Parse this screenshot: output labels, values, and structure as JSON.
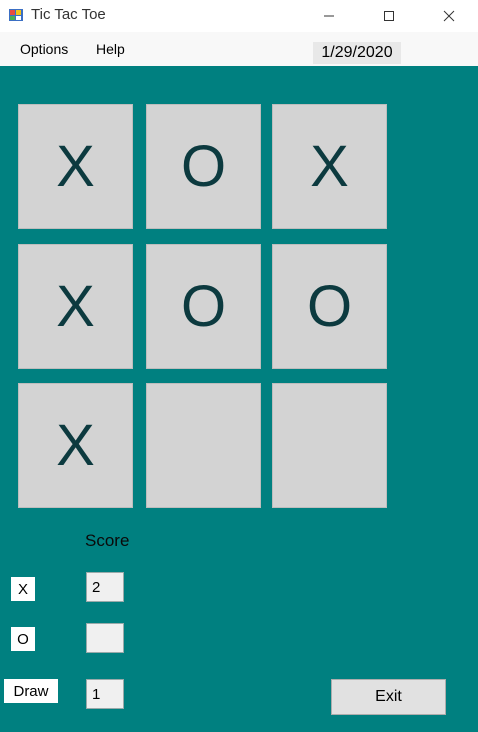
{
  "window": {
    "title": "Tic Tac Toe"
  },
  "menu": {
    "options": "Options",
    "help": "Help"
  },
  "date": "1/29/2020",
  "board": {
    "cells": [
      "X",
      "O",
      "X",
      "X",
      "O",
      "O",
      "X",
      "",
      ""
    ]
  },
  "score": {
    "title": "Score",
    "x_label": "X",
    "x_value": "2",
    "o_label": "O",
    "o_value": "",
    "draw_label": "Draw",
    "draw_value": "1"
  },
  "exit_label": "Exit",
  "colors": {
    "background": "#008080",
    "cell": "#d3d3d3",
    "mark": "#0c3a3f"
  }
}
